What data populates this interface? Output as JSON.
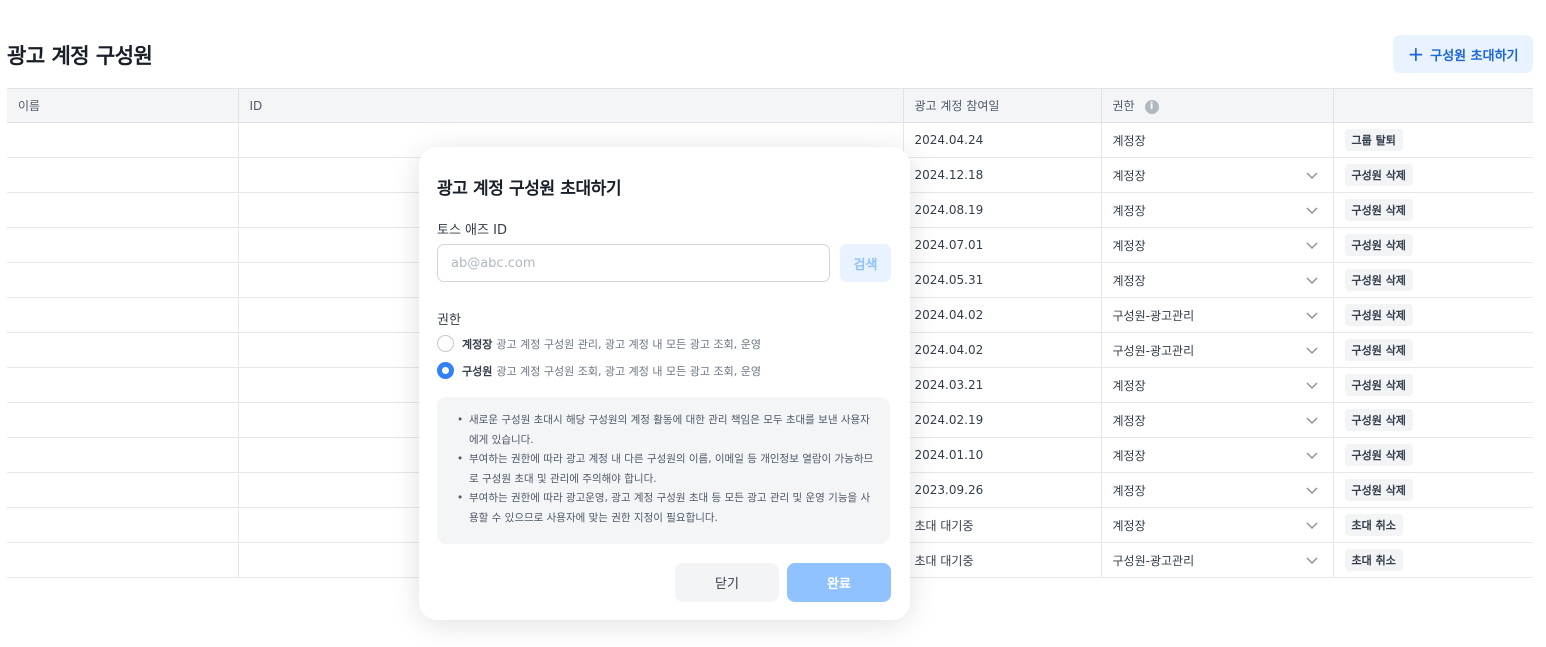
{
  "header": {
    "title": "광고 계정 구성원",
    "invite_label": "구성원 초대하기"
  },
  "table": {
    "columns": [
      "이름",
      "ID",
      "광고 계정 참여일",
      "권한",
      ""
    ],
    "rows": [
      {
        "date": "2024.04.24",
        "role": "계정장",
        "dropdown": false,
        "action": "그룹 탈퇴"
      },
      {
        "date": "2024.12.18",
        "role": "계정장",
        "dropdown": true,
        "action": "구성원 삭제"
      },
      {
        "date": "2024.08.19",
        "role": "계정장",
        "dropdown": true,
        "action": "구성원 삭제"
      },
      {
        "date": "2024.07.01",
        "role": "계정장",
        "dropdown": true,
        "action": "구성원 삭제"
      },
      {
        "date": "2024.05.31",
        "role": "계정장",
        "dropdown": true,
        "action": "구성원 삭제"
      },
      {
        "date": "2024.04.02",
        "role": "구성원-광고관리",
        "dropdown": true,
        "action": "구성원 삭제"
      },
      {
        "date": "2024.04.02",
        "role": "구성원-광고관리",
        "dropdown": true,
        "action": "구성원 삭제"
      },
      {
        "date": "2024.03.21",
        "role": "계정장",
        "dropdown": true,
        "action": "구성원 삭제"
      },
      {
        "date": "2024.02.19",
        "role": "계정장",
        "dropdown": true,
        "action": "구성원 삭제"
      },
      {
        "date": "2024.01.10",
        "role": "계정장",
        "dropdown": true,
        "action": "구성원 삭제"
      },
      {
        "date": "2023.09.26",
        "role": "계정장",
        "dropdown": true,
        "action": "구성원 삭제"
      },
      {
        "date": "초대 대기중",
        "role": "계정장",
        "dropdown": true,
        "action": "초대 취소"
      },
      {
        "date": "초대 대기중",
        "role": "구성원-광고관리",
        "dropdown": true,
        "action": "초대 취소"
      }
    ]
  },
  "dialog": {
    "title": "광고 계정 구성원 초대하기",
    "id_label": "토스 애즈 ID",
    "id_placeholder": "ab@abc.com",
    "search_label": "검색",
    "permission_label": "권한",
    "options": [
      {
        "name": "계정장",
        "desc": "광고 계정 구성원 관리, 광고 계정 내 모든 광고 조회, 운영",
        "selected": false
      },
      {
        "name": "구성원",
        "desc": "광고 계정 구성원 조회, 광고 계정 내 모든 광고 조회, 운영",
        "selected": true
      }
    ],
    "notice": [
      "새로운 구성원 초대시 해당 구성원의 계정 활동에 대한 관리 책임은 모두 초대를 보낸 사용자에게 있습니다.",
      "부여하는 권한에 따라 광고 계정 내 다른 구성원의 이름, 이메일 등 개인정보 열람이 가능하므로 구성원 초대 및 관리에 주의해야 합니다.",
      "부여하는 권한에 따라 광고운영, 광고 계정 구성원 초대 등 모든 광고 관리 및 운영 기능을 사용할 수 있으므로 사용자에 맞는 권한 지정이 필요합니다."
    ],
    "close_label": "닫기",
    "done_label": "완료"
  },
  "colors": {
    "accent": "#3182f6",
    "accent_light": "#e8f3ff",
    "disabled_primary": "#90c2ff"
  }
}
